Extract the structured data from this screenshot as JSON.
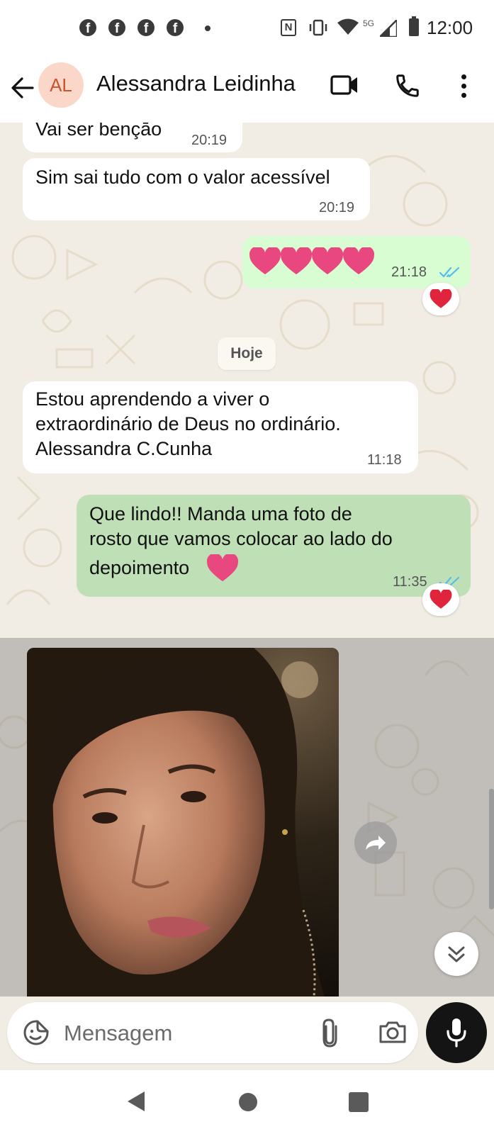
{
  "status_bar": {
    "time": "12:00",
    "network": "5G",
    "nfc_label": "N",
    "notification_icon_letter": "f",
    "icons": [
      "facebook-icon",
      "facebook-icon",
      "facebook-icon",
      "facebook-icon",
      "dot-icon",
      "nfc-icon",
      "vibrate-icon",
      "wifi-icon",
      "signal-icon",
      "battery-icon"
    ]
  },
  "header": {
    "avatar_initials": "AL",
    "contact_name": "Alessandra Leidinha",
    "icons": [
      "back-arrow-icon",
      "video-call-icon",
      "phone-icon",
      "more-vert-icon"
    ]
  },
  "messages": [
    {
      "direction": "in",
      "text": "Vai ser bençāo",
      "time": "20:19"
    },
    {
      "direction": "in",
      "text": "Sim sai tudo com o valor acessível",
      "time": "20:19"
    },
    {
      "direction": "out",
      "emoji": "💗💗💗💗",
      "time": "21:18",
      "read": true,
      "reaction": "❤️"
    },
    {
      "direction": "in",
      "lines": [
        "Estou aprendendo a viver o",
        "extraordinário de Deus no ordinário.",
        "Alessandra C.Cunha"
      ],
      "time": "11:18"
    },
    {
      "direction": "out",
      "lines": [
        "Que lindo!! Manda uma foto de",
        "rosto que vamos colocar ao lado do",
        "depoimento"
      ],
      "line_emoji": "💗",
      "time": "11:35",
      "read": true,
      "reaction": "❤️"
    },
    {
      "direction": "in",
      "type": "image",
      "description_icon": "photo",
      "selected": true
    }
  ],
  "date_separator": "Hoje",
  "input": {
    "placeholder": "Mensagem",
    "icons": [
      "emoji-sticker-icon",
      "attach-icon",
      "camera-icon",
      "mic-icon"
    ]
  },
  "controls": {
    "forward_icon": "forward-icon",
    "scroll_down_icon": "double-chevron-down-icon"
  },
  "colors": {
    "outgoing_bubble": "#d8fdd2",
    "incoming_bubble": "#ffffff",
    "chat_background": "#f2ede4",
    "read_ticks": "#53bdeb",
    "avatar_bg": "#fbd7c9",
    "avatar_text": "#c9542d",
    "heart": "#e0245e"
  }
}
